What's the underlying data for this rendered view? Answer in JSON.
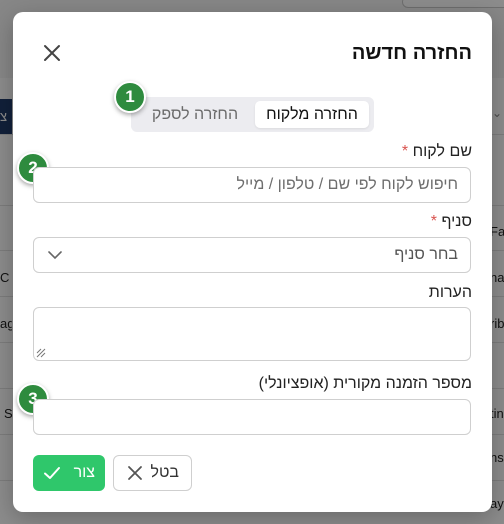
{
  "background": {
    "row_fragments": [
      "Fa",
      "na",
      "rib",
      "tin",
      "ns",
      "ay",
      "C",
      "ag",
      "S",
      "צ"
    ]
  },
  "modal": {
    "title": "החזרה חדשה",
    "close_icon": "close-icon",
    "tabs": [
      {
        "label": "החזרה מלקוח",
        "active": true
      },
      {
        "label": "החזרה לספק",
        "active": false
      }
    ],
    "badges": [
      "1",
      "2",
      "3"
    ],
    "customer": {
      "label": "שם לקוח",
      "required_mark": "*",
      "placeholder": "חיפוש לקוח לפי שם / טלפון / מייל",
      "value": ""
    },
    "branch": {
      "label": "סניף",
      "required_mark": "*",
      "selected": "בחר סניף"
    },
    "notes": {
      "label": "הערות",
      "value": ""
    },
    "order_number": {
      "label": "מספר הזמנה מקורית (אופציונלי)",
      "value": ""
    },
    "buttons": {
      "save": "צור",
      "cancel": "בטל"
    },
    "colors": {
      "accent_green": "#2fc76b",
      "badge_green": "#2e8b3e",
      "required_red": "#d9534f"
    }
  }
}
